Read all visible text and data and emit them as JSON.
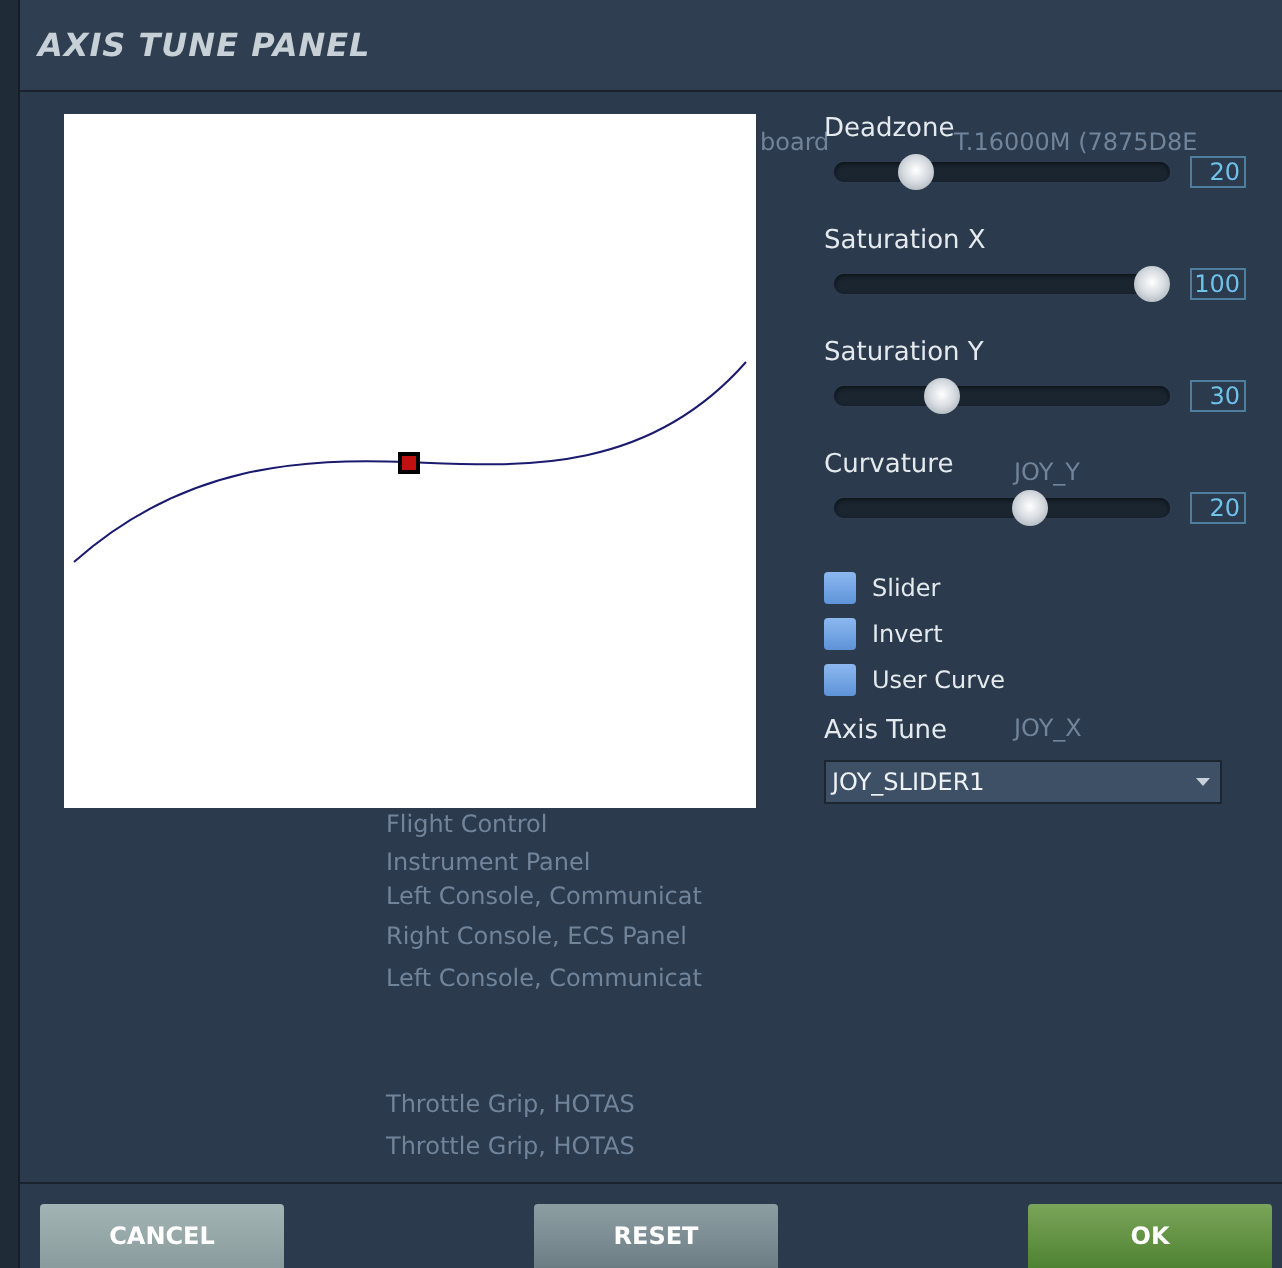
{
  "window": {
    "title": "AXIS TUNE PANEL"
  },
  "background_labels": [
    "board",
    "T.16000M (7875D8E",
    "JOY_Y",
    "JOY_X",
    "Flight Control",
    "Instrument Panel",
    "Left Console, Communicat",
    "Right Console, ECS Panel",
    "Left Console, Communicat",
    "Throttle Grip, HOTAS",
    "Throttle Grip, HOTAS"
  ],
  "sliders": [
    {
      "label": "Deadzone",
      "level": 0.21,
      "reading": "20"
    },
    {
      "label": "Saturation X",
      "level": 1.0,
      "reading": "100"
    },
    {
      "label": "Saturation Y",
      "level": 0.3,
      "reading": "30"
    },
    {
      "label": "Curvature",
      "level": 0.59,
      "reading": "20"
    }
  ],
  "checkboxes": [
    {
      "label": "Slider",
      "checked": false
    },
    {
      "label": "Invert",
      "checked": false
    },
    {
      "label": "User Curve",
      "checked": false
    }
  ],
  "axis_tune": {
    "label": "Axis Tune",
    "value": "JOY_SLIDER1"
  },
  "buttons": [
    {
      "label": "CANCEL",
      "kind": "cancel"
    },
    {
      "label": "RESET",
      "kind": "reset"
    },
    {
      "label": "OK",
      "kind": "ok"
    }
  ]
}
